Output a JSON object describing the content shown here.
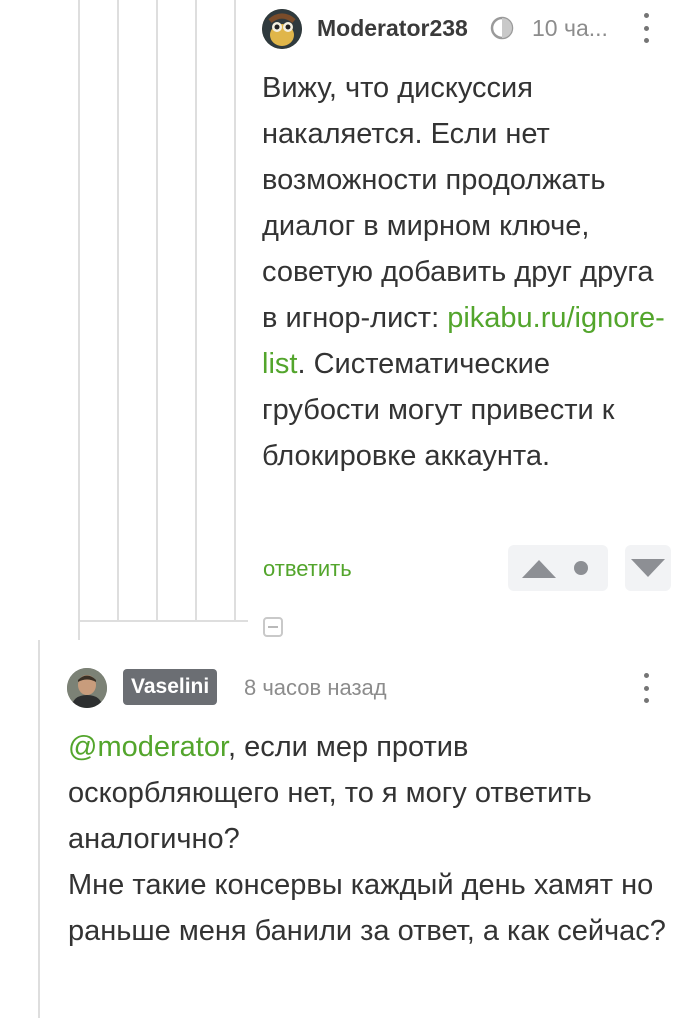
{
  "comment1": {
    "username": "Moderator238",
    "time": "10 ча...",
    "text_before_link": "Вижу, что дискуссия накаляется. Если нет возможности продолжать диалог в мирном ключе, советую добавить друг друга в игнор-лист: ",
    "link": "pikabu.ru/ignore-list",
    "text_after_link": ". Систематические грубости могут привести к блокировке аккаунта.",
    "reply_label": "ответить"
  },
  "comment2": {
    "username": "Vaselini",
    "time": "8 часов назад",
    "mention": "@moderator",
    "text": ", если мер против оскорбляющего нет, то я могу ответить аналогично?\nМне такие консервы каждый день хамят но раньше меня банили за ответ, а как сейчас?"
  },
  "colors": {
    "link_green": "#53a52c",
    "badge_gray": "#6b6e73",
    "thread_line": "#dedede"
  },
  "icons": [
    "moderator-badge-icon",
    "more-vertical-icon",
    "upvote-icon",
    "downvote-icon",
    "collapse-icon"
  ]
}
